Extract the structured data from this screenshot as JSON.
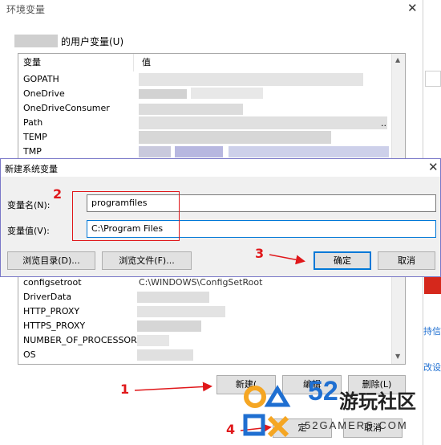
{
  "env_window": {
    "title": "环境变量",
    "user_vars_label": "的用户变量(U)",
    "columns": [
      "变量",
      "值"
    ],
    "user_vars": [
      "GOPATH",
      "OneDrive",
      "OneDriveConsumer",
      "Path",
      "TEMP",
      "TMP"
    ],
    "path_trailing": "..",
    "sys_partial_row": "configsetroot",
    "sys_partial_value": "C:\\WINDOWS\\ConfigSetRoot",
    "sys_vars": [
      "DriverData",
      "HTTP_PROXY",
      "HTTPS_PROXY",
      "NUMBER_OF_PROCESSORS",
      "OS"
    ],
    "buttons": {
      "new": "新建(",
      "edit": "编辑",
      "delete": "删除(L)",
      "ok_partial": "定",
      "cancel_partial": "取消"
    }
  },
  "dialog": {
    "title": "新建系统变量",
    "name_label": "变量名(N):",
    "name_value": "programfiles",
    "value_label": "变量值(V):",
    "value_value": "C:\\Program Files",
    "browse_dir": "浏览目录(D)...",
    "browse_file": "浏览文件(F)...",
    "ok": "确定",
    "cancel": "取消"
  },
  "annotations": {
    "n1": "1",
    "n2": "2",
    "n3": "3",
    "n4": "4"
  },
  "edge_fragments": {
    "e1": "持信",
    "e2": "改设"
  },
  "watermark": {
    "number": "52",
    "brand": "游玩社区",
    "url": "52GAMERS.COM"
  },
  "colors": {
    "annotation_red": "#e0171a",
    "dialog_border": "#7a78c8",
    "focus_blue": "#0078d7",
    "watermark_orange": "#f5a623",
    "watermark_blue": "#1f6fd1"
  }
}
